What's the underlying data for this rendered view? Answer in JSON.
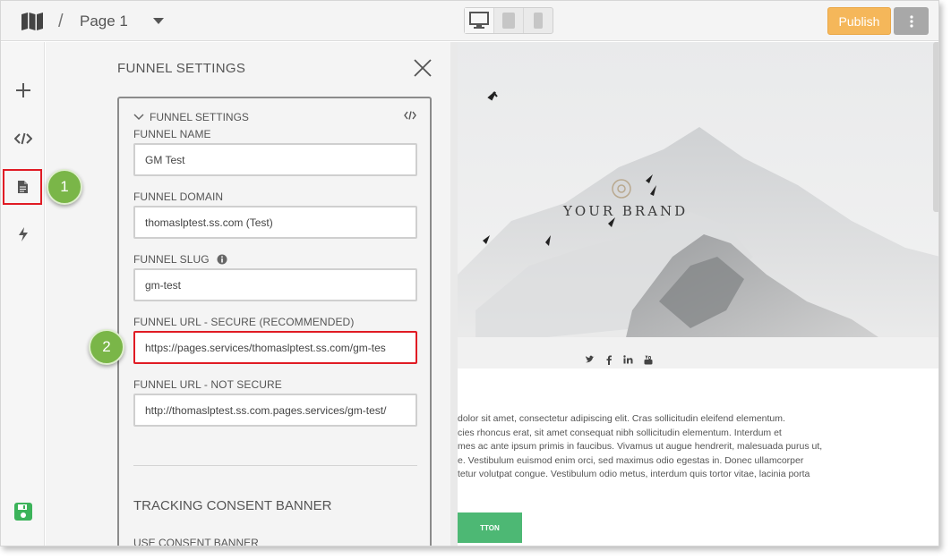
{
  "header": {
    "separator": "/",
    "page_title": "Page 1",
    "publish_label": "Publish",
    "device_modes": [
      "desktop",
      "tablet",
      "mobile"
    ]
  },
  "rail": {
    "items": [
      "add-icon",
      "code-icon",
      "page-settings-icon",
      "bolt-icon",
      "save-icon"
    ]
  },
  "panel": {
    "title": "FUNNEL SETTINGS",
    "section_title": "FUNNEL SETTINGS",
    "fields": [
      {
        "label": "FUNNEL NAME",
        "value": "GM Test"
      },
      {
        "label": "FUNNEL DOMAIN",
        "value": "thomaslptest.ss.com (Test)"
      },
      {
        "label": "FUNNEL SLUG",
        "value": "gm-test"
      },
      {
        "label": "FUNNEL URL - SECURE (RECOMMENDED)",
        "value": "https://pages.services/thomaslptest.ss.com/gm-tes"
      },
      {
        "label": "FUNNEL URL - NOT SECURE",
        "value": "http://thomaslptest.ss.com.pages.services/gm-test/"
      }
    ],
    "tracking_title": "TRACKING CONSENT BANNER",
    "consent_label": "USE CONSENT BANNER"
  },
  "callouts": {
    "one": "1",
    "two": "2"
  },
  "preview": {
    "brand": "YOUR BRAND",
    "lorem_lines": [
      "dolor sit amet, consectetur adipiscing elit. Cras sollicitudin eleifend elementum.",
      "cies rhoncus erat, sit amet consequat nibh sollicitudin elementum. Interdum et",
      "mes ac ante ipsum primis in faucibus. Vivamus ut augue hendrerit, malesuada purus ut,",
      "e. Vestibulum euismod enim orci, sed maximus odio egestas in. Donec ullamcorper",
      "tetur volutpat congue. Vestibulum odio metus, interdum quis tortor vitae, lacinia porta"
    ],
    "cta_label": "TTON",
    "social_icons": [
      "twitter-icon",
      "facebook-icon",
      "linkedin-icon",
      "youtube-icon"
    ],
    "colors": {
      "cta": "#4db874",
      "publish": "#f5b75a",
      "badge": "#7ab648",
      "highlight": "#e01b24"
    }
  }
}
